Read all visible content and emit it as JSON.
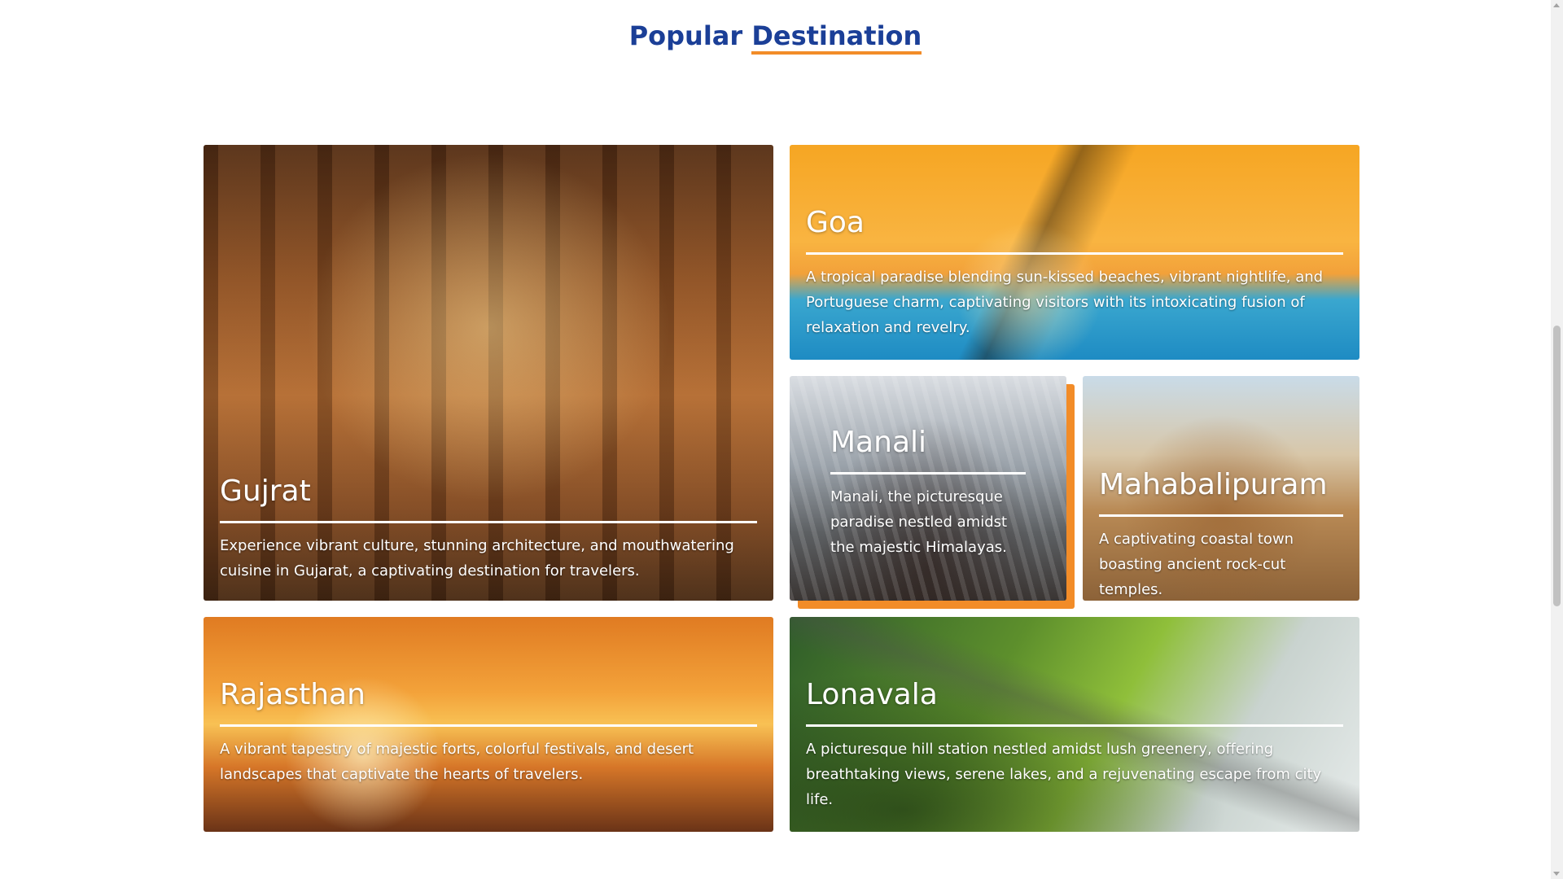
{
  "section": {
    "title_prefix": "Popular",
    "title_accent": "Destination"
  },
  "destinations": [
    {
      "name": "Gujrat",
      "description": "Experience vibrant culture, stunning architecture, and mouthwatering cuisine in Gujarat, a captivating destination for travelers."
    },
    {
      "name": "Goa",
      "description": "A tropical paradise blending sun-kissed beaches, vibrant nightlife, and Portuguese charm, captivating visitors with its intoxicating fusion of relaxation and revelry."
    },
    {
      "name": "Manali",
      "description": "Manali, the picturesque paradise nestled amidst the majestic Himalayas."
    },
    {
      "name": "Mahabalipuram",
      "description": "A captivating coastal town boasting ancient rock-cut temples."
    },
    {
      "name": "Rajasthan",
      "description": "A vibrant tapestry of majestic forts, colorful festivals, and desert landscapes that captivate the hearts of travelers."
    },
    {
      "name": "Lonavala",
      "description": "A picturesque hill station nestled amidst lush greenery, offering breathtaking views, serene lakes, and a rejuvenating escape from city life."
    }
  ],
  "colors": {
    "title_blue": "#1b3f97",
    "accent_orange": "#f28c28",
    "card_text": "#ffffff"
  }
}
